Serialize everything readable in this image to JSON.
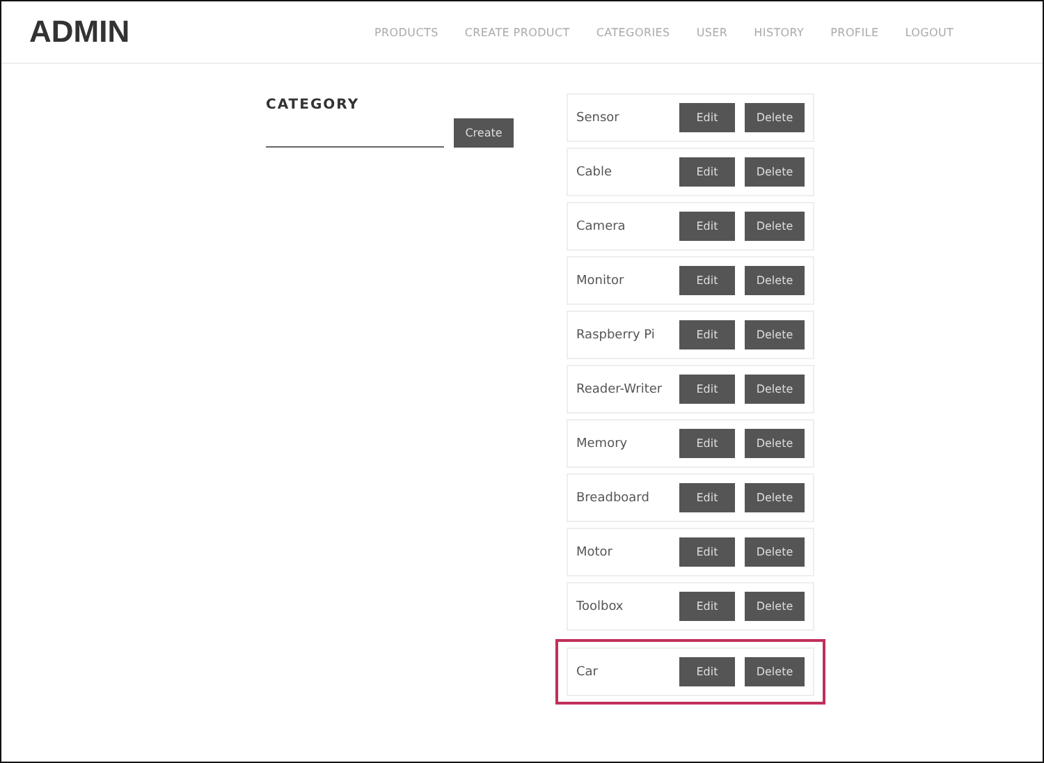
{
  "brand": "ADMIN",
  "nav": [
    {
      "label": "PRODUCTS"
    },
    {
      "label": "CREATE PRODUCT"
    },
    {
      "label": "CATEGORIES"
    },
    {
      "label": "USER"
    },
    {
      "label": "HISTORY"
    },
    {
      "label": "PROFILE"
    },
    {
      "label": "LOGOUT"
    }
  ],
  "form": {
    "title": "CATEGORY",
    "button": "Create"
  },
  "categories": [
    {
      "name": "Sensor",
      "edit": "Edit",
      "delete": "Delete",
      "highlighted": false
    },
    {
      "name": "Cable",
      "edit": "Edit",
      "delete": "Delete",
      "highlighted": false
    },
    {
      "name": "Camera",
      "edit": "Edit",
      "delete": "Delete",
      "highlighted": false
    },
    {
      "name": "Monitor",
      "edit": "Edit",
      "delete": "Delete",
      "highlighted": false
    },
    {
      "name": "Raspberry Pi",
      "edit": "Edit",
      "delete": "Delete",
      "highlighted": false
    },
    {
      "name": "Reader-Writer",
      "edit": "Edit",
      "delete": "Delete",
      "highlighted": false
    },
    {
      "name": "Memory",
      "edit": "Edit",
      "delete": "Delete",
      "highlighted": false
    },
    {
      "name": "Breadboard",
      "edit": "Edit",
      "delete": "Delete",
      "highlighted": false
    },
    {
      "name": "Motor",
      "edit": "Edit",
      "delete": "Delete",
      "highlighted": false
    },
    {
      "name": "Toolbox",
      "edit": "Edit",
      "delete": "Delete",
      "highlighted": false
    },
    {
      "name": "Car",
      "edit": "Edit",
      "delete": "Delete",
      "highlighted": true
    }
  ]
}
